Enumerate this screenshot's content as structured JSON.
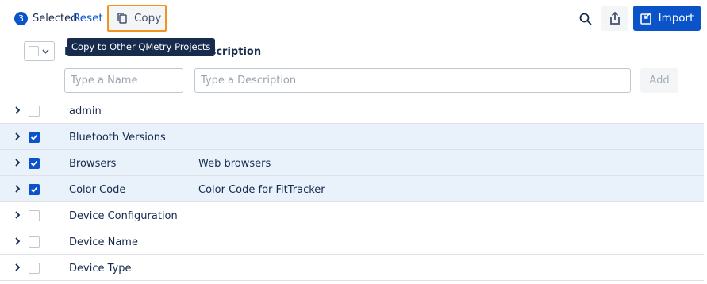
{
  "toolbar": {
    "selected_count": "3",
    "selected_label": "Selected",
    "reset_label": "Reset",
    "copy_label": "Copy",
    "copy_tooltip": "Copy to Other QMetry Projects",
    "import_label": "Import"
  },
  "table": {
    "header": {
      "name": "Name",
      "description": "Description"
    },
    "filters": {
      "name_placeholder": "Type a Name",
      "description_placeholder": "Type a Description",
      "add_label": "Add"
    },
    "rows": [
      {
        "name": "admin",
        "description": "",
        "checked": false
      },
      {
        "name": "Bluetooth Versions",
        "description": "",
        "checked": true
      },
      {
        "name": "Browsers",
        "description": "Web browsers",
        "checked": true
      },
      {
        "name": "Color Code",
        "description": "Color Code for FitTracker",
        "checked": true
      },
      {
        "name": "Device Configuration",
        "description": "",
        "checked": false
      },
      {
        "name": "Device Name",
        "description": "",
        "checked": false
      },
      {
        "name": "Device Type",
        "description": "",
        "checked": false
      }
    ]
  },
  "colors": {
    "accent": "#0b53c9",
    "highlight_border": "#f0941f",
    "selected_row": "#e9f2fb"
  }
}
